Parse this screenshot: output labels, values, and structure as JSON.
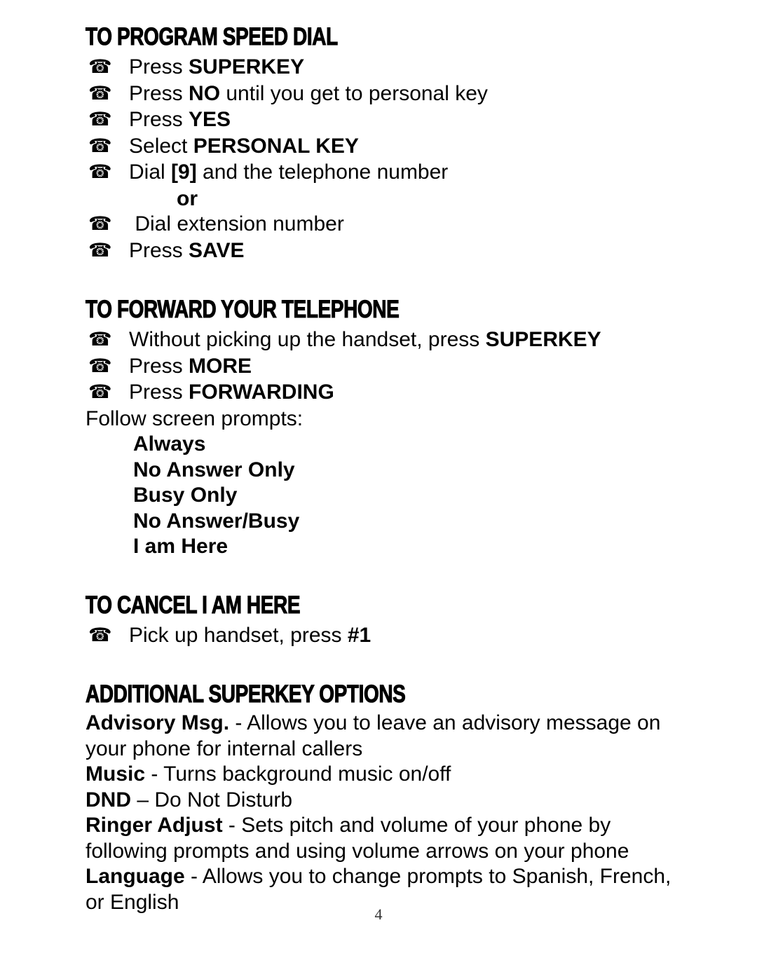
{
  "page": {
    "number": "4",
    "bullet_glyph": "☎",
    "bullet_icon_name": "telephone-bullet-icon",
    "text_color": "#000000",
    "background_color": "#ffffff"
  },
  "sections": [
    {
      "id": "to-program-speed-dial",
      "heading": "TO PROGRAM SPEED DIAL",
      "steps": [
        {
          "prefix": "Press ",
          "strong": "SUPERKEY",
          "suffix": ""
        },
        {
          "prefix": "Press ",
          "strong": "NO",
          "suffix": " until you get to personal key"
        },
        {
          "prefix": "Press ",
          "strong": "YES",
          "suffix": ""
        },
        {
          "prefix": "Select ",
          "strong": "PERSONAL KEY",
          "suffix": ""
        },
        {
          "prefix": "Dial ",
          "strong": "[9]",
          "suffix": " and the telephone number"
        }
      ],
      "or_label": "or",
      "steps_after_or": [
        {
          "prefix": " Dial extension number",
          "strong": "",
          "suffix": ""
        },
        {
          "prefix": "Press ",
          "strong": "SAVE",
          "suffix": ""
        }
      ]
    },
    {
      "id": "to-forward-your-telephone",
      "heading": "TO FORWARD YOUR TELEPHONE",
      "steps": [
        {
          "prefix": "Without picking up the handset, press ",
          "strong": "SUPERKEY",
          "suffix": ""
        },
        {
          "prefix": "Press ",
          "strong": "MORE",
          "suffix": ""
        },
        {
          "prefix": "Press ",
          "strong": "FORWARDING",
          "suffix": ""
        }
      ],
      "follow_label": "Follow screen prompts:",
      "prompts": [
        "Always",
        "No Answer Only",
        "Busy Only",
        "No Answer/Busy",
        "I am Here"
      ]
    },
    {
      "id": "to-cancel-i-am-here",
      "heading": "TO CANCEL I AM HERE",
      "steps": [
        {
          "prefix": "Pick up handset, press ",
          "strong": "#1",
          "suffix": ""
        }
      ]
    },
    {
      "id": "additional-superkey-options",
      "heading": "ADDITIONAL SUPERKEY OPTIONS",
      "options": [
        {
          "term": "Advisory Msg.",
          "separator": " - ",
          "definition": "Allows you to leave an advisory message on your phone for internal callers"
        },
        {
          "term": "Music",
          "separator": " - ",
          "definition": "Turns background music on/off"
        },
        {
          "term": "DND",
          "separator": " – ",
          "definition": "Do Not Disturb"
        },
        {
          "term": "Ringer Adjust",
          "separator": " - ",
          "definition": "Sets pitch and volume of your phone by following prompts and using volume arrows on your phone"
        },
        {
          "term": "Language",
          "separator": " - ",
          "definition": "Allows you to change prompts to Spanish, French, or English"
        }
      ]
    }
  ]
}
